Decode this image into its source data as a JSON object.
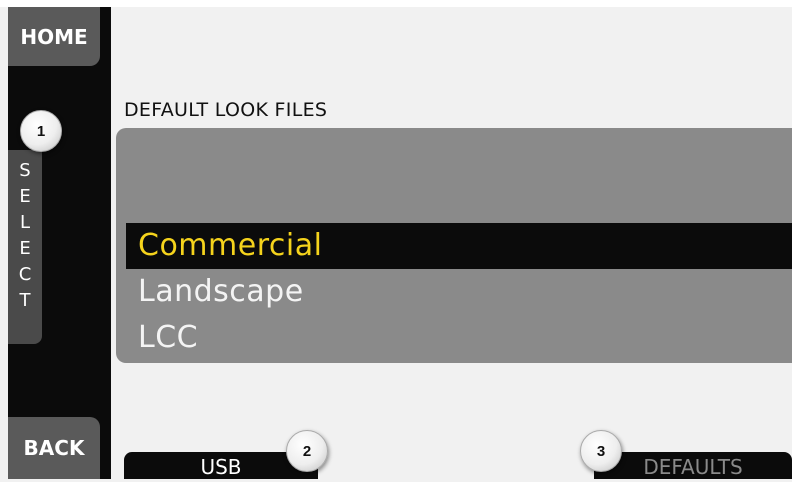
{
  "sidebar": {
    "home_label": "HOME",
    "back_label": "BACK",
    "select_letters": [
      "S",
      "E",
      "L",
      "E",
      "C",
      "T"
    ]
  },
  "main": {
    "title": "DEFAULT LOOK FILES",
    "items": [
      {
        "label": "Commercial",
        "selected": true
      },
      {
        "label": "Landscape",
        "selected": false
      },
      {
        "label": "LCC",
        "selected": false
      }
    ]
  },
  "bottom": {
    "usb_label": "USB",
    "defaults_label": "DEFAULTS"
  },
  "callouts": [
    "1",
    "2",
    "3"
  ],
  "colors": {
    "selected_text": "#f5d31c",
    "panel": "#8a8a8a",
    "bar": "#0b0b0b",
    "button": "#5a5a5a"
  }
}
